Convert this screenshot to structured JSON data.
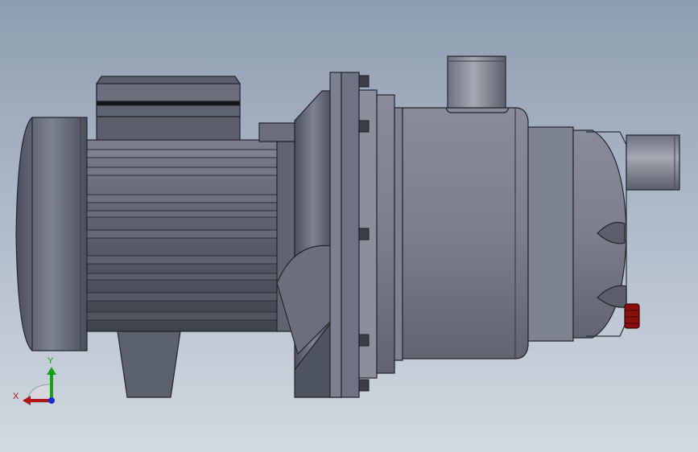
{
  "triad": {
    "x_label": "X",
    "y_label": "Y"
  },
  "colors": {
    "background_top": "#8e9db0",
    "background_bottom": "#d2d9e1",
    "metal_dark": "#4e5361",
    "metal_mid": "#6f7482",
    "metal_light": "#9a9fab",
    "outline": "#23262d",
    "drain_plug": "#8a1010",
    "axis_x": "#b01515",
    "axis_y": "#18a018",
    "axis_z": "#1c2ad0"
  },
  "icons": {
    "triad": "coordinate-triad-icon"
  }
}
